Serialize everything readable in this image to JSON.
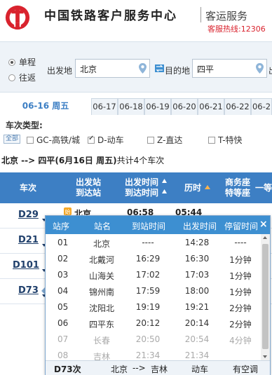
{
  "header": {
    "brand": "中国铁路客户服务中心",
    "sub": "客运服务",
    "hotline": "客服热线:12306"
  },
  "search": {
    "one_way": "单程",
    "round_trip": "往返",
    "from_label": "出发地",
    "from_value": "北京",
    "to_label": "目的地",
    "to_value": "四平",
    "date_label_cut": "出"
  },
  "dates": {
    "active": "06-16 周五",
    "tabs": [
      "06-17",
      "06-18",
      "06-19",
      "06-20",
      "06-21",
      "06-22",
      "06-2"
    ]
  },
  "filter": {
    "title": "车次类型:",
    "all": "全部",
    "types": [
      {
        "label": "GC-高铁/城",
        "checked": false
      },
      {
        "label": "D-动车",
        "checked": true
      },
      {
        "label": "Z-直达",
        "checked": false
      },
      {
        "label": "T-特快",
        "checked": false
      }
    ]
  },
  "summary": {
    "route": "北京 --> 四平",
    "date": "(6月16日 周五)",
    "count": "共计4个车次"
  },
  "table": {
    "col_train": "车次",
    "col_station_1": "出发站",
    "col_station_2": "到达站",
    "col_time_1": "出发时间",
    "col_time_2": "到达时间",
    "col_duration": "历时",
    "col_business_1": "商务座",
    "col_business_2": "特等座",
    "col_first_cut": "一等"
  },
  "trains": [
    {
      "code": "D29",
      "from_station": "北京",
      "depart": "06:58",
      "duration": "05:44"
    },
    {
      "code": "D21"
    },
    {
      "code": "D101"
    },
    {
      "code": "D73"
    }
  ],
  "popup": {
    "headers": [
      "站序",
      "站名",
      "到站时间",
      "出发时间",
      "停留时间"
    ],
    "close": "×",
    "rows": [
      {
        "seq": "01",
        "name": "北京",
        "arrive": "----",
        "depart": "14:28",
        "stay": "----",
        "dim": false
      },
      {
        "seq": "02",
        "name": "北戴河",
        "arrive": "16:29",
        "depart": "16:30",
        "stay": "1分钟",
        "dim": false
      },
      {
        "seq": "03",
        "name": "山海关",
        "arrive": "17:02",
        "depart": "17:03",
        "stay": "1分钟",
        "dim": false
      },
      {
        "seq": "04",
        "name": "锦州南",
        "arrive": "17:59",
        "depart": "18:00",
        "stay": "1分钟",
        "dim": false
      },
      {
        "seq": "05",
        "name": "沈阳北",
        "arrive": "19:19",
        "depart": "19:21",
        "stay": "2分钟",
        "dim": false
      },
      {
        "seq": "06",
        "name": "四平东",
        "arrive": "20:12",
        "depart": "20:14",
        "stay": "2分钟",
        "dim": false
      },
      {
        "seq": "07",
        "name": "长春",
        "arrive": "20:50",
        "depart": "20:54",
        "stay": "4分钟",
        "dim": true
      },
      {
        "seq": "08",
        "name": "吉林",
        "arrive": "21:34",
        "depart": "21:34",
        "stay": "----",
        "dim": true
      }
    ],
    "footer": {
      "train": "D73次",
      "from": "北京",
      "arrow": "-->",
      "to": "吉林",
      "type": "动车",
      "ac": "有空调"
    }
  },
  "colors": {
    "accent": "#3d7fc4",
    "popup_header": "#3d8fd1",
    "hotline": "#d9232e"
  }
}
